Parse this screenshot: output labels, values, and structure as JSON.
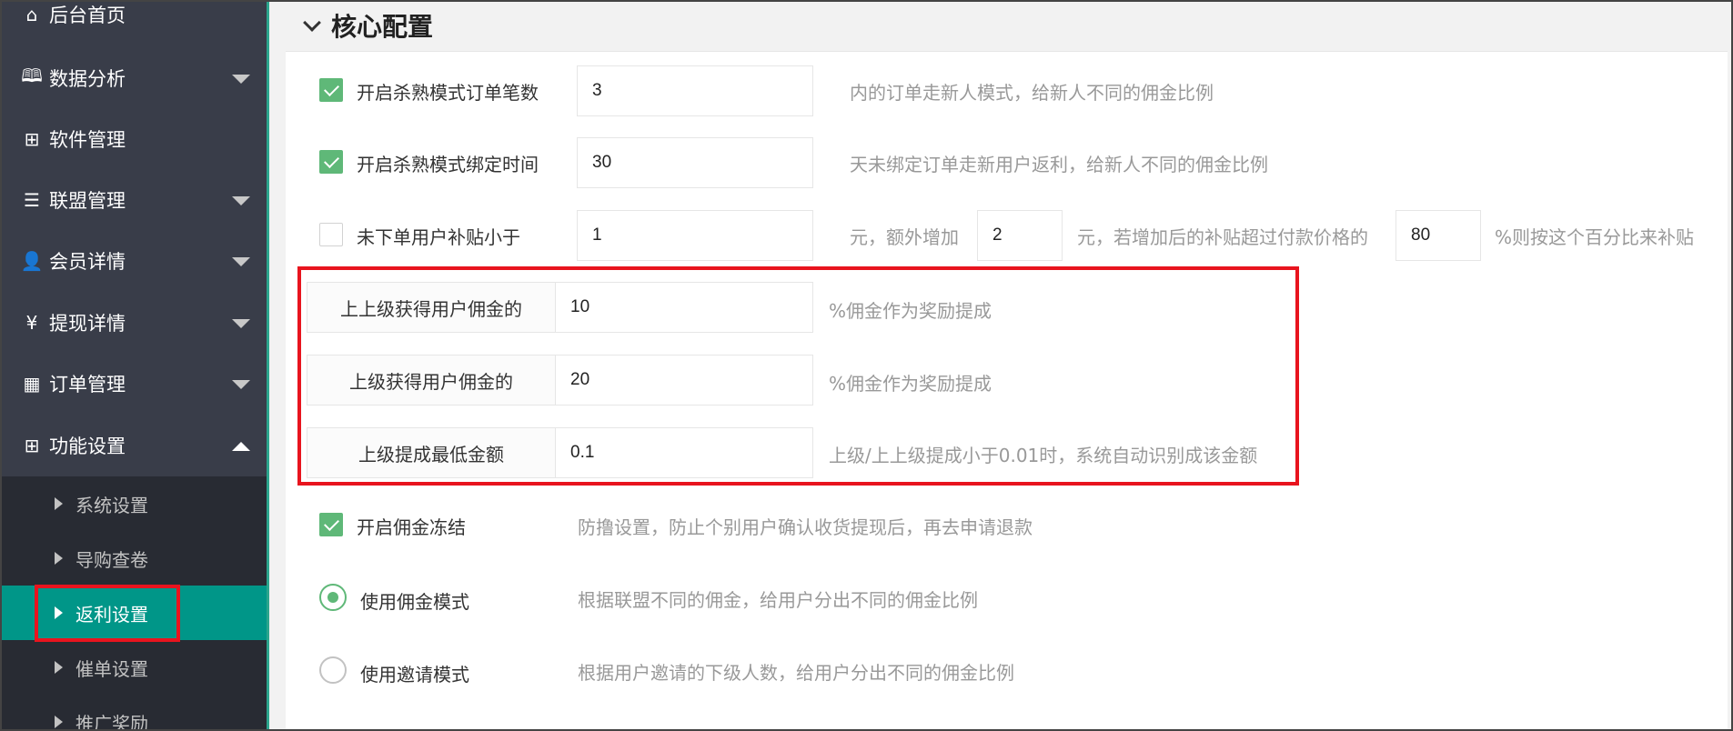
{
  "sidebar": {
    "items": [
      {
        "label": "后台首页",
        "icon": "home-icon"
      },
      {
        "label": "数据分析",
        "icon": "book-icon"
      },
      {
        "label": "软件管理",
        "icon": "apps-icon"
      },
      {
        "label": "联盟管理",
        "icon": "list-icon"
      },
      {
        "label": "会员详情",
        "icon": "user-icon"
      },
      {
        "label": "提现详情",
        "icon": "yen-icon"
      },
      {
        "label": "订单管理",
        "icon": "grid-icon"
      },
      {
        "label": "功能设置",
        "icon": "apps-icon"
      }
    ],
    "sub_items": [
      {
        "label": "系统设置"
      },
      {
        "label": "导购查卷"
      },
      {
        "label": "返利设置"
      },
      {
        "label": "催单设置"
      },
      {
        "label": "推广奖励"
      }
    ]
  },
  "panel": {
    "title": "核心配置"
  },
  "form": {
    "killer_orders": {
      "label": "开启杀熟模式订单笔数",
      "value": "3",
      "hint": "内的订单走新人模式，给新人不同的佣金比例",
      "checked": true
    },
    "killer_time": {
      "label": "开启杀熟模式绑定时间",
      "value": "30",
      "hint": "天未绑定订单走新用户返利，给新人不同的佣金比例",
      "checked": true
    },
    "subsidy": {
      "label": "未下单用户补贴小于",
      "value1": "1",
      "text1": "元，额外增加",
      "value2": "2",
      "text2": "元，若增加后的补贴超过付款价格的",
      "value3": "80",
      "text3": "%则按这个百分比来补贴",
      "checked": false
    },
    "grand_commission": {
      "label": "上上级获得用户佣金的",
      "value": "10",
      "hint": "%佣金作为奖励提成"
    },
    "parent_commission": {
      "label": "上级获得用户佣金的",
      "value": "20",
      "hint": "%佣金作为奖励提成"
    },
    "min_amount": {
      "label": "上级提成最低金额",
      "value": "0.1",
      "hint": "上级/上上级提成小于0.01时，系统自动识别成该金额"
    },
    "freeze": {
      "label": "开启佣金冻结",
      "hint": "防撸设置，防止个别用户确认收货提现后，再去申请退款",
      "checked": true
    },
    "commission_mode": {
      "label": "使用佣金模式",
      "hint": "根据联盟不同的佣金，给用户分出不同的佣金比例",
      "checked": true
    },
    "invite_mode": {
      "label": "使用邀请模式",
      "hint": "根据用户邀请的下级人数，给用户分出不同的佣金比例",
      "checked": false
    }
  }
}
